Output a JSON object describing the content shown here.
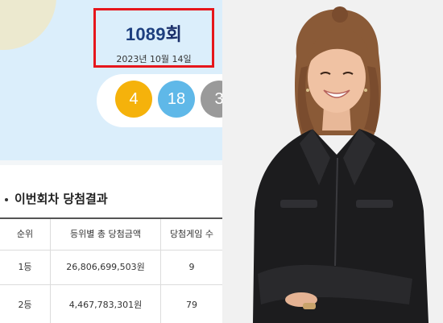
{
  "round": {
    "number": "1089",
    "unit": "회",
    "date": "2023년 10월 14일"
  },
  "balls": [
    "4",
    "18",
    "3"
  ],
  "results": {
    "title": "이번회차 당첨결과",
    "headers": [
      "순위",
      "등위별 총 당첨금액",
      "당첨게임 수"
    ],
    "rows": [
      [
        "1등",
        "26,806,699,503원",
        "9"
      ],
      [
        "2등",
        "4,467,783,301원",
        "79"
      ]
    ]
  },
  "colors": {
    "highlight_border": "#e6161c",
    "ball_yellow": "#f5b20b",
    "ball_blue": "#5fb8e8",
    "ball_gray": "#9a9a9a",
    "hero_bg": "#dbeefb"
  }
}
